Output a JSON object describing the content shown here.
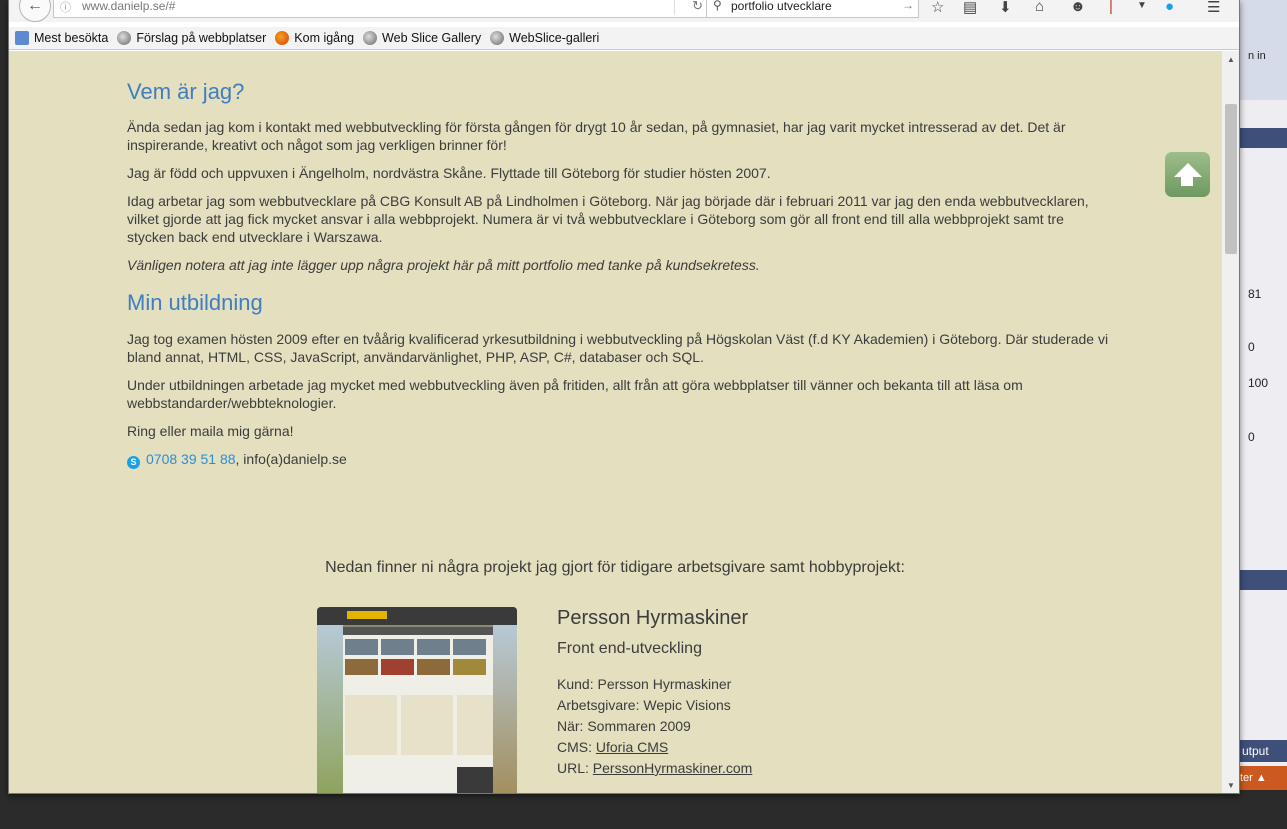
{
  "browser": {
    "url": "www.danielp.se/#",
    "search_query": "portfolio utvecklare",
    "bookmarks": [
      "Mest besökta",
      "Förslag på webbplatser",
      "Kom igång",
      "Web Slice Gallery",
      "WebSlice-galleri"
    ]
  },
  "background_app": {
    "numbers": [
      "81",
      "0",
      "100",
      "0"
    ],
    "output_label": "utput",
    "filter_label": "ter ▲",
    "sign_in": "n in"
  },
  "about": {
    "heading": "Vem är jag?",
    "p1": "Ända sedan jag kom i kontakt med webbutveckling för första gången för drygt 10 år sedan, på gymnasiet, har jag varit mycket intresserad av det. Det är inspirerande, kreativt och något som jag verkligen brinner för!",
    "p2": "Jag är född och uppvuxen i Ängelholm, nordvästra Skåne. Flyttade till Göteborg för studier hösten 2007.",
    "p3": "Idag arbetar jag som webbutvecklare på CBG Konsult AB på Lindholmen i Göteborg. När jag började där i februari 2011 var jag den enda webbutvecklaren, vilket gjorde att jag fick mycket ansvar i alla webbprojekt. Numera är vi två webbutvecklare i Göteborg som gör all front end till alla webbprojekt samt tre stycken back end utvecklare i Warszawa.",
    "p4": "Vänligen notera att jag inte lägger upp några projekt här på mitt portfolio med tanke på kundsekretess."
  },
  "education": {
    "heading": "Min utbildning",
    "p1": "Jag tog examen hösten 2009 efter en tvåårig kvalificerad yrkesutbildning i webbutveckling på Högskolan Väst (f.d KY Akademien) i Göteborg. Där studerade vi bland annat, HTML, CSS, JavaScript, användarvänlighet, PHP, ASP, C#, databaser och SQL.",
    "p2": "Under utbildningen arbetade jag mycket med webbutveckling även på fritiden, allt från att göra webbplatser till vänner och bekanta till att läsa om webbstandarder/webbteknologier.",
    "p3": "Ring eller maila mig gärna!",
    "phone": "0708 39 51 88",
    "email": ", info(a)danielp.se"
  },
  "projects": {
    "intro": "Nedan finner ni några projekt jag gjort för tidigare arbetsgivare samt hobbyprojekt:",
    "items": [
      {
        "title": "Persson Hyrmaskiner",
        "role": "Front end-utveckling",
        "client_label": "Kund: ",
        "client": "Persson Hyrmaskiner",
        "employer_label": "Arbetsgivare: ",
        "employer": "Wepic Visions",
        "when_label": "När: ",
        "when": "Sommaren 2009",
        "cms_label": "CMS: ",
        "cms": "Uforia CMS",
        "url_label": "URL: ",
        "url": "PerssonHyrmaskiner.com"
      }
    ]
  }
}
